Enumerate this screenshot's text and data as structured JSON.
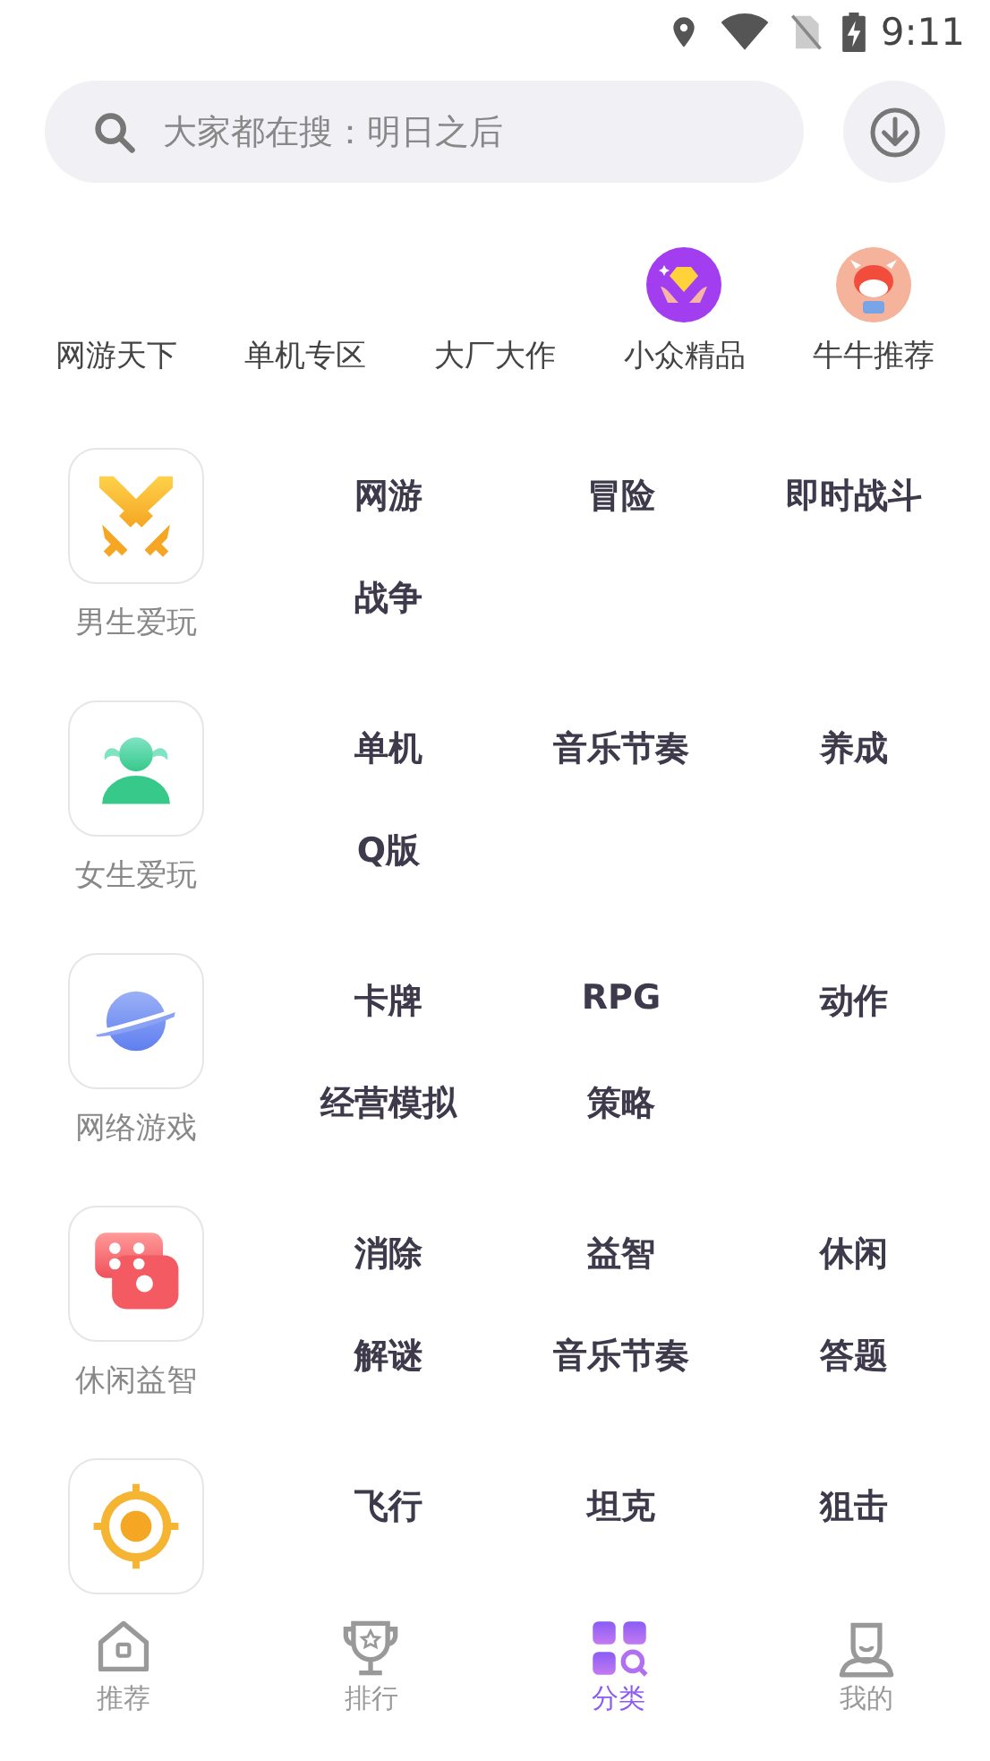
{
  "status_bar": {
    "time": "9:11"
  },
  "search": {
    "placeholder": "大家都在搜：明日之后"
  },
  "quick_categories": [
    {
      "label": "网游天下"
    },
    {
      "label": "单机专区"
    },
    {
      "label": "大厂大作"
    },
    {
      "label": "小众精品"
    },
    {
      "label": "牛牛推荐"
    }
  ],
  "groups": [
    {
      "label": "男生爱玩",
      "tags": [
        "网游",
        "冒险",
        "即时战斗",
        "战争"
      ]
    },
    {
      "label": "女生爱玩",
      "tags": [
        "单机",
        "音乐节奏",
        "养成",
        "Q版"
      ]
    },
    {
      "label": "网络游戏",
      "tags": [
        "卡牌",
        "RPG",
        "动作",
        "经营模拟",
        "策略"
      ]
    },
    {
      "label": "休闲益智",
      "tags": [
        "消除",
        "益智",
        "休闲",
        "解谜",
        "音乐节奏",
        "答题"
      ]
    },
    {
      "tags": [
        "飞行",
        "坦克",
        "狙击"
      ]
    }
  ],
  "nav": [
    {
      "label": "推荐",
      "selected": false
    },
    {
      "label": "排行",
      "selected": false
    },
    {
      "label": "分类",
      "selected": true
    },
    {
      "label": "我的",
      "selected": false
    }
  ]
}
